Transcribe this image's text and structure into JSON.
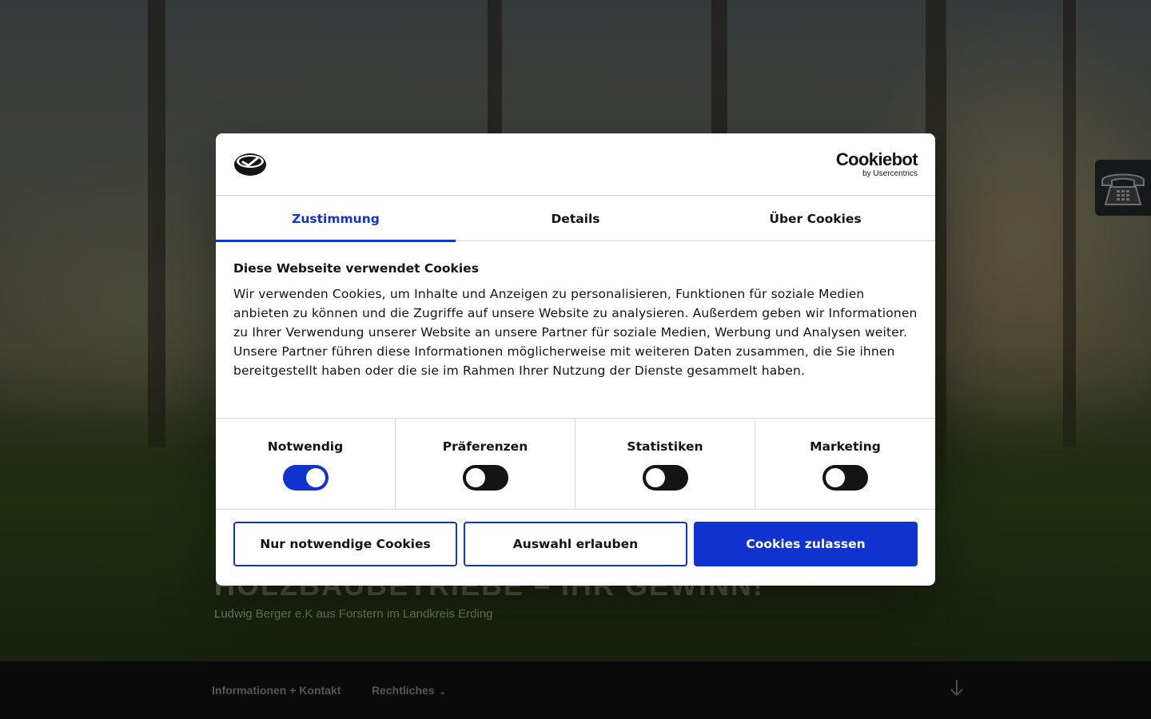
{
  "site": {
    "title": "HOLZBAUBETRIEBE – IHR GEWINN!",
    "description": "Ludwig Berger e.K aus Forstern im Landkreis Erding"
  },
  "nav": {
    "items": [
      {
        "label": "Informationen + Kontakt"
      },
      {
        "label": "Rechtliches"
      }
    ]
  },
  "cookie_dialog": {
    "brand": {
      "name": "Cookiebot",
      "sub": "by Usercentrics"
    },
    "tabs": [
      {
        "label": "Zustimmung",
        "active": true
      },
      {
        "label": "Details",
        "active": false
      },
      {
        "label": "Über Cookies",
        "active": false
      }
    ],
    "heading": "Diese Webseite verwendet Cookies",
    "text": "Wir verwenden Cookies, um Inhalte und Anzeigen zu personalisieren, Funktionen für soziale Medien anbieten zu können und die Zugriffe auf unsere Website zu analysieren. Außerdem geben wir Informationen zu Ihrer Verwendung unserer Website an unsere Partner für soziale Medien, Werbung und Analysen weiter. Unsere Partner führen diese Informationen möglicherweise mit weiteren Daten zusammen, die Sie ihnen bereitgestellt haben oder die sie im Rahmen Ihrer Nutzung der Dienste gesammelt haben.",
    "categories": [
      {
        "label": "Notwendig",
        "enabled": true
      },
      {
        "label": "Präferenzen",
        "enabled": false
      },
      {
        "label": "Statistiken",
        "enabled": false
      },
      {
        "label": "Marketing",
        "enabled": false
      }
    ],
    "buttons": {
      "necessary_only": "Nur notwendige Cookies",
      "allow_selection": "Auswahl erlauben",
      "allow_all": "Cookies zulassen"
    }
  },
  "colors": {
    "accent": "#1032cf",
    "text": "#141414",
    "divider": "#d6d6d6",
    "nav_bg": "#0a0a0b"
  },
  "icons": {
    "dialog_logo": "cookiebot-logo-icon",
    "phone_widget": "telephone-icon",
    "scroll": "arrow-down-icon",
    "nav_dropdown": "chevron-down-icon"
  }
}
